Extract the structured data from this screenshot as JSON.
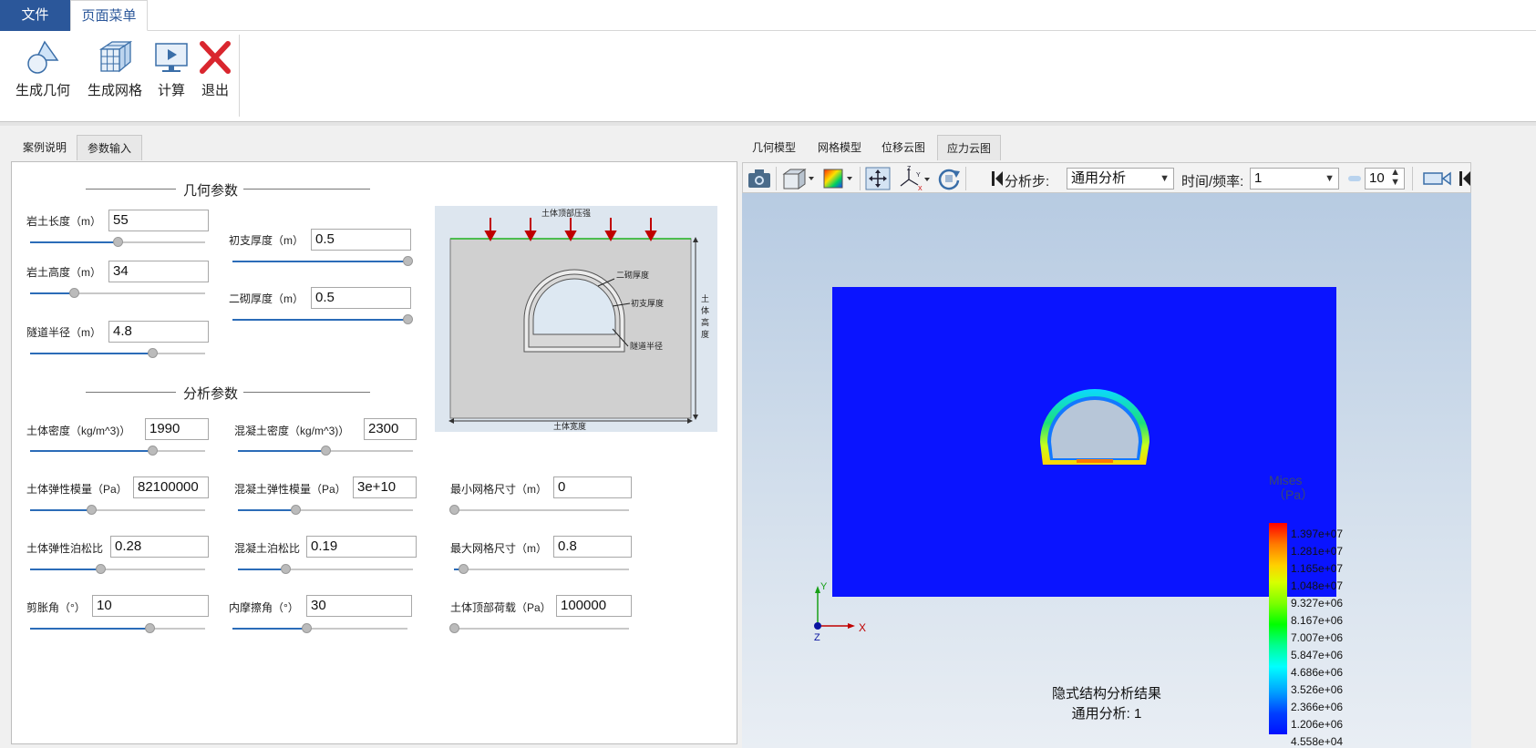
{
  "ribbon": {
    "tabs": [
      "文件",
      "页面菜单"
    ],
    "buttons": [
      "生成几何",
      "生成网格",
      "计算",
      "退出"
    ]
  },
  "left_tabs": [
    "案例说明",
    "参数输入"
  ],
  "geometry": {
    "title": "几何参数",
    "rock_length": {
      "label": "岩土长度（m）",
      "value": "55",
      "level": 0.5
    },
    "rock_height": {
      "label": "岩土高度（m）",
      "value": "34",
      "level": 0.25
    },
    "tunnel_radius": {
      "label": "隧道半径（m）",
      "value": "4.8",
      "level": 0.7
    },
    "primary_thickness": {
      "label": "初支厚度（m）",
      "value": "0.5",
      "level": 1.0
    },
    "secondary_thickness": {
      "label": "二砌厚度（m）",
      "value": "0.5",
      "level": 1.0
    }
  },
  "analysis": {
    "title": "分析参数",
    "soil_density": {
      "label": "土体密度（kg/m^3)）",
      "value": "1990",
      "level": 0.7
    },
    "concrete_density": {
      "label": "混凝土密度（kg/m^3)）",
      "value": "2300",
      "level": 0.5
    },
    "soil_modulus": {
      "label": "土体弹性模量（Pa）",
      "value": "82100000",
      "level": 0.35
    },
    "concrete_modulus": {
      "label": "混凝土弹性模量（Pa）",
      "value": "3e+10",
      "level": 0.33
    },
    "min_mesh": {
      "label": "最小网格尺寸（m）",
      "value": "0",
      "level": 0.0
    },
    "soil_poisson": {
      "label": "土体弹性泊松比",
      "value": "0.28",
      "level": 0.4
    },
    "concrete_poisson": {
      "label": "混凝土泊松比",
      "value": "0.19",
      "level": 0.27
    },
    "max_mesh": {
      "label": "最大网格尺寸（m）",
      "value": "0.8",
      "level": 0.05
    },
    "dilation_angle": {
      "label": "剪胀角（°）",
      "value": "10",
      "level": 0.68
    },
    "friction_angle": {
      "label": "内摩擦角（°）",
      "value": "30",
      "level": 0.42
    },
    "top_load": {
      "label": "土体顶部荷载（Pa）",
      "value": "100000",
      "level": 0.0
    }
  },
  "diagram": {
    "top_pressure": "土体顶部压强",
    "secondary_lining": "二砌厚度",
    "primary_support": "初支厚度",
    "tunnel_radius": "隧道半径",
    "soil_height": [
      "土",
      "体",
      "高",
      "度"
    ],
    "soil_width": "土体宽度"
  },
  "right_tabs": [
    "几何模型",
    "网格模型",
    "位移云图",
    "应力云图"
  ],
  "view_toolbar": {
    "step_label": "分析步:",
    "step_value": "通用分析",
    "time_label": "时间/频率:",
    "time_value": "1",
    "spin_value": "10"
  },
  "legend": {
    "title": "Mises",
    "unit": "（Pa）",
    "labels": [
      "1.397e+07",
      "1.281e+07",
      "1.165e+07",
      "1.048e+07",
      "9.327e+06",
      "8.167e+06",
      "7.007e+06",
      "5.847e+06",
      "4.686e+06",
      "3.526e+06",
      "2.366e+06",
      "1.206e+06",
      "4.558e+04"
    ]
  },
  "axes": {
    "x": "X",
    "y": "Y",
    "z": "Z"
  },
  "result": {
    "title": "隐式结构分析结果",
    "step": "通用分析: 1"
  },
  "colors": {
    "accent": "#2b579a",
    "mesh": "#0a14ff",
    "arrow": "#c00000"
  }
}
